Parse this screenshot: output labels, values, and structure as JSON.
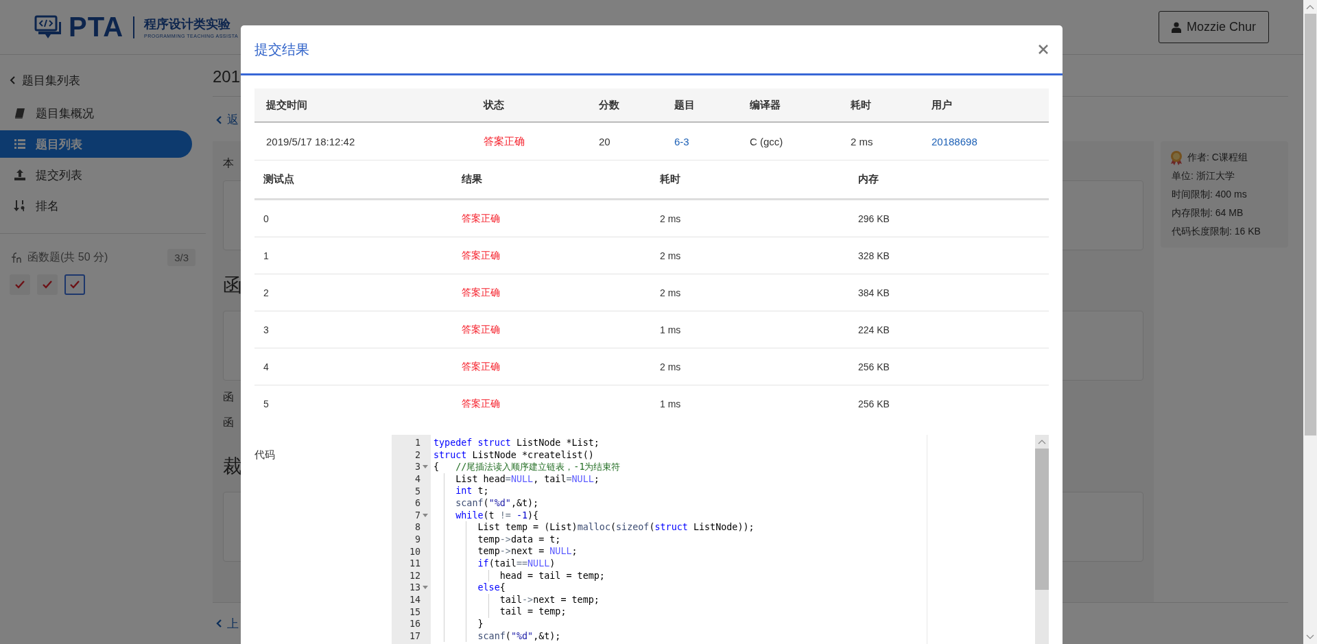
{
  "header": {
    "logo_text": "PTA",
    "logo_title": "程序设计类实验",
    "logo_subtitle": "PROGRAMMING TEACHING ASSISTA",
    "user_button": "Mozzie Chur"
  },
  "sidebar": {
    "back_link": "题目集列表",
    "items": [
      {
        "label": "题目集概况",
        "kind": "book",
        "selected": false
      },
      {
        "label": "题目列表",
        "kind": "list",
        "selected": true
      },
      {
        "label": "提交列表",
        "kind": "upload",
        "selected": false
      },
      {
        "label": "排名",
        "kind": "sort",
        "selected": false
      }
    ],
    "section": {
      "title": "函数题(共 50 分)",
      "count": "3/3",
      "problems": [
        {
          "selected": false
        },
        {
          "selected": false
        },
        {
          "selected": true
        }
      ]
    }
  },
  "page": {
    "title": "201",
    "back_link": "返",
    "blocks": [
      {
        "kind": "label",
        "text": "本"
      },
      {
        "kind": "sample_box"
      },
      {
        "kind": "heading",
        "text": "函"
      },
      {
        "kind": "sample_box"
      },
      {
        "kind": "label",
        "text": "函"
      },
      {
        "kind": "label",
        "text": "函"
      },
      {
        "kind": "heading",
        "text": "裁"
      },
      {
        "kind": "sample_box"
      }
    ],
    "prev_link": "上"
  },
  "info": {
    "author": "作者: C课程组",
    "lines": [
      "单位: 浙江大学",
      "时间限制: 400 ms",
      "内存限制: 64 MB",
      "代码长度限制: 16 KB"
    ]
  },
  "modal": {
    "title": "提交结果",
    "summary": {
      "columns": [
        "提交时间",
        "状态",
        "分数",
        "题目",
        "编译器",
        "耗时",
        "用户"
      ],
      "row": [
        {
          "kind": "text",
          "text": "2019/5/17 18:12:42"
        },
        {
          "kind": "status",
          "text": "答案正确"
        },
        {
          "kind": "text",
          "text": "20"
        },
        {
          "kind": "link",
          "text": "6-3"
        },
        {
          "kind": "text",
          "text": "C (gcc)"
        },
        {
          "kind": "text",
          "text": "2 ms"
        },
        {
          "kind": "link",
          "text": "20188698"
        }
      ]
    },
    "tests": {
      "columns": [
        "测试点",
        "结果",
        "耗时",
        "内存"
      ],
      "rows": [
        {
          "case": "0",
          "result": "答案正确",
          "time": "2 ms",
          "memory": "296 KB"
        },
        {
          "case": "1",
          "result": "答案正确",
          "time": "2 ms",
          "memory": "328 KB"
        },
        {
          "case": "2",
          "result": "答案正确",
          "time": "2 ms",
          "memory": "384 KB"
        },
        {
          "case": "3",
          "result": "答案正确",
          "time": "1 ms",
          "memory": "224 KB"
        },
        {
          "case": "4",
          "result": "答案正确",
          "time": "2 ms",
          "memory": "256 KB"
        },
        {
          "case": "5",
          "result": "答案正确",
          "time": "1 ms",
          "memory": "256 KB"
        }
      ]
    },
    "code_label": "代码",
    "code": {
      "lines": [
        {
          "n": "1",
          "fold": false,
          "tokens": [
            {
              "kind": "keyword",
              "text": "typedef "
            },
            {
              "kind": "keyword",
              "text": "struct"
            },
            {
              "kind": "plain",
              "text": " ListNode *List;"
            }
          ]
        },
        {
          "n": "2",
          "fold": false,
          "tokens": [
            {
              "kind": "keyword",
              "text": "struct"
            },
            {
              "kind": "plain",
              "text": " ListNode *createlist()"
            }
          ]
        },
        {
          "n": "3",
          "fold": true,
          "tokens": [
            {
              "kind": "plain",
              "text": "{   "
            },
            {
              "kind": "comment",
              "text": "//尾插法读入顺序建立链表，-1为结束符"
            }
          ]
        },
        {
          "n": "4",
          "fold": false,
          "tokens": [
            {
              "kind": "plain",
              "text": "    List head"
            },
            {
              "kind": "operator",
              "text": "="
            },
            {
              "kind": "constant",
              "text": "NULL"
            },
            {
              "kind": "plain",
              "text": ", tail"
            },
            {
              "kind": "operator",
              "text": "="
            },
            {
              "kind": "constant",
              "text": "NULL"
            },
            {
              "kind": "plain",
              "text": ";"
            }
          ]
        },
        {
          "n": "5",
          "fold": false,
          "tokens": [
            {
              "kind": "keyword",
              "text": "    int"
            },
            {
              "kind": "plain",
              "text": " t;"
            }
          ]
        },
        {
          "n": "6",
          "fold": false,
          "tokens": [
            {
              "kind": "function",
              "text": "    scanf"
            },
            {
              "kind": "plain",
              "text": "("
            },
            {
              "kind": "string",
              "text": "\"%d\""
            },
            {
              "kind": "plain",
              "text": ",&t);"
            }
          ]
        },
        {
          "n": "7",
          "fold": true,
          "tokens": [
            {
              "kind": "keyword",
              "text": "    while"
            },
            {
              "kind": "plain",
              "text": "(t "
            },
            {
              "kind": "operator",
              "text": "!= "
            },
            {
              "kind": "number",
              "text": "-1"
            },
            {
              "kind": "plain",
              "text": "){"
            }
          ]
        },
        {
          "n": "8",
          "fold": false,
          "tokens": [
            {
              "kind": "plain",
              "text": "        List temp = (List)"
            },
            {
              "kind": "function",
              "text": "malloc"
            },
            {
              "kind": "plain",
              "text": "("
            },
            {
              "kind": "function",
              "text": "sizeof"
            },
            {
              "kind": "plain",
              "text": "("
            },
            {
              "kind": "keyword",
              "text": "struct"
            },
            {
              "kind": "plain",
              "text": " ListNode));"
            }
          ]
        },
        {
          "n": "9",
          "fold": false,
          "tokens": [
            {
              "kind": "plain",
              "text": "        temp"
            },
            {
              "kind": "operator",
              "text": "->"
            },
            {
              "kind": "plain",
              "text": "data = t;"
            }
          ]
        },
        {
          "n": "10",
          "fold": false,
          "tokens": [
            {
              "kind": "plain",
              "text": "        temp"
            },
            {
              "kind": "operator",
              "text": "->"
            },
            {
              "kind": "plain",
              "text": "next = "
            },
            {
              "kind": "constant",
              "text": "NULL"
            },
            {
              "kind": "plain",
              "text": ";"
            }
          ]
        },
        {
          "n": "11",
          "fold": false,
          "tokens": [
            {
              "kind": "keyword",
              "text": "        if"
            },
            {
              "kind": "plain",
              "text": "(tail"
            },
            {
              "kind": "operator",
              "text": "=="
            },
            {
              "kind": "constant",
              "text": "NULL"
            },
            {
              "kind": "plain",
              "text": ")"
            }
          ]
        },
        {
          "n": "12",
          "fold": false,
          "tokens": [
            {
              "kind": "plain",
              "text": "            head = tail = temp;"
            }
          ]
        },
        {
          "n": "13",
          "fold": true,
          "tokens": [
            {
              "kind": "keyword",
              "text": "        else"
            },
            {
              "kind": "plain",
              "text": "{"
            }
          ]
        },
        {
          "n": "14",
          "fold": false,
          "tokens": [
            {
              "kind": "plain",
              "text": "            tail"
            },
            {
              "kind": "operator",
              "text": "->"
            },
            {
              "kind": "plain",
              "text": "next = temp;"
            }
          ]
        },
        {
          "n": "15",
          "fold": false,
          "tokens": [
            {
              "kind": "plain",
              "text": "            tail = temp;"
            }
          ]
        },
        {
          "n": "16",
          "fold": false,
          "tokens": [
            {
              "kind": "plain",
              "text": "        }"
            }
          ]
        },
        {
          "n": "17",
          "fold": false,
          "tokens": [
            {
              "kind": "function",
              "text": "        scanf"
            },
            {
              "kind": "plain",
              "text": "("
            },
            {
              "kind": "string",
              "text": "\"%d\""
            },
            {
              "kind": "plain",
              "text": ",&t);"
            }
          ]
        }
      ]
    }
  }
}
